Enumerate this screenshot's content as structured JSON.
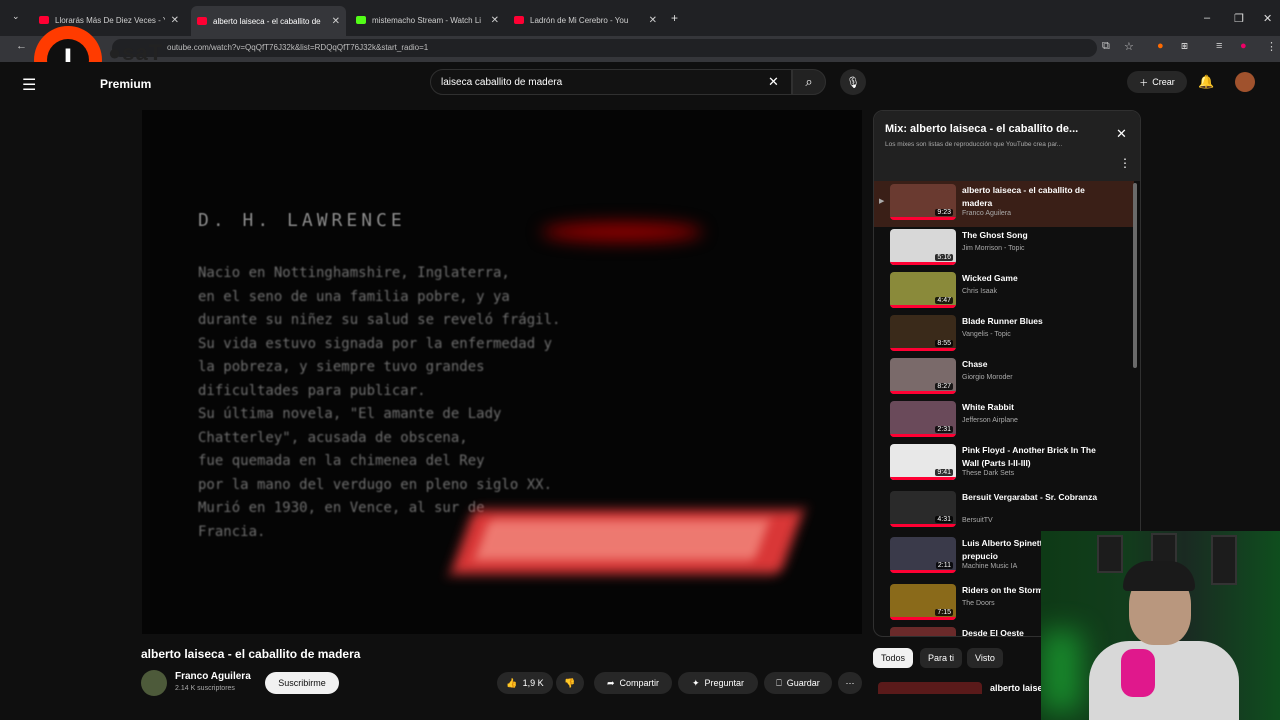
{
  "browser": {
    "tabs": [
      {
        "label": "Llorarás Más De Diez Veces - Y",
        "kind": "youtube"
      },
      {
        "label": "alberto laiseca - el caballito de",
        "kind": "youtube"
      },
      {
        "label": "mistemacho Stream - Watch Li",
        "kind": "kick"
      },
      {
        "label": "Ladrón de Mi Cerebro - You",
        "kind": "youtube"
      }
    ],
    "new_tab": "+",
    "url": "outube.com/watch?v=QqQfT76J32k&list=RDQqQfT76J32k&start_radio=1",
    "colors": {
      "tabstrip": "#202124",
      "toolbar": "#35363a"
    }
  },
  "overlay": {
    "logo_letter": "I",
    "logo_text": "●saT",
    "logo_color": "#ff3b00"
  },
  "header": {
    "premium": "Premium",
    "search_value": "laiseca caballito de madera",
    "create": "Crear"
  },
  "video": {
    "heading": "D. H. LAWRENCE",
    "body": "Nacio en Nottinghamshire, Inglaterra,\nen el seno de una familia pobre, y ya\ndurante su niñez su salud se reveló frágil.\nSu vida estuvo signada por la enfermedad y\nla pobreza, y siempre tuvo grandes\ndificultades para publicar.\nSu última novela, \"El amante de Lady\nChatterley\", acusada de obscena,\nfue quemada en la chimenea del Rey\npor la mano del verdugo en pleno siglo XX.\nMurió en 1930, en Vence, al sur de\nFrancia.",
    "title": "alberto laiseca - el caballito de madera",
    "channel": "Franco Aguilera",
    "subscribers": "2.14 K suscriptores",
    "subscribe": "Suscribirme",
    "likes": "1,9 K",
    "share": "Compartir",
    "ask": "Preguntar",
    "save": "Guardar"
  },
  "playlist": {
    "title": "Mix: alberto laiseca - el caballito de...",
    "subtitle": "Los mixes son listas de reproducción que YouTube crea par...",
    "items": [
      {
        "title": "alberto laiseca - el caballito de madera",
        "channel": "Franco Aguilera",
        "duration": "9:23",
        "thumb": "#6a3a30",
        "active": true
      },
      {
        "title": "The Ghost Song",
        "channel": "Jim Morrison - Topic",
        "duration": "5:16",
        "thumb": "#d8d8d8"
      },
      {
        "title": "Wicked Game",
        "channel": "Chris Isaak",
        "duration": "4:47",
        "thumb": "#8a8a3a"
      },
      {
        "title": "Blade Runner Blues",
        "channel": "Vangelis - Topic",
        "duration": "8:55",
        "thumb": "#3a2a1a"
      },
      {
        "title": "Chase",
        "channel": "Giorgio Moroder",
        "duration": "8:27",
        "thumb": "#7a6a6a"
      },
      {
        "title": "White Rabbit",
        "channel": "Jefferson Airplane",
        "duration": "2:31",
        "thumb": "#6a4a5a"
      },
      {
        "title": "Pink Floyd - Another Brick In The Wall (Parts I-II-III)",
        "channel": "These Dark Sets",
        "duration": "9:41",
        "thumb": "#e8e8e8"
      },
      {
        "title": "Bersuit Vergarabat - Sr. Cobranza",
        "channel": "BersuitTV",
        "duration": "4:31",
        "thumb": "#2a2a2a"
      },
      {
        "title": "Luis Alberto Spinetta hombre prepucio",
        "channel": "Machine Music IA",
        "duration": "2:11",
        "thumb": "#3a3a4a"
      },
      {
        "title": "Riders on the Storm",
        "channel": "The Doors",
        "duration": "7:15",
        "thumb": "#8a6a1a"
      },
      {
        "title": "Desde El Oeste",
        "channel": "",
        "duration": "",
        "thumb": "#6a2a2a"
      }
    ]
  },
  "chips": [
    "Todos",
    "Para ti",
    "Visto"
  ],
  "next_up_title": "alberto laise"
}
